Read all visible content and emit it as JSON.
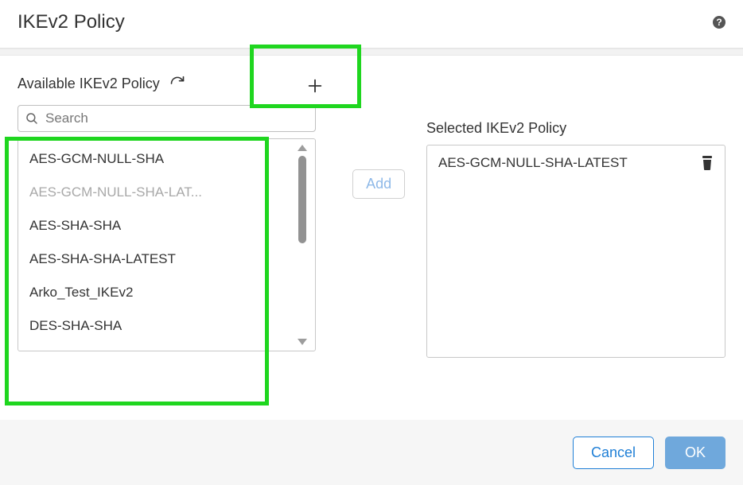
{
  "header": {
    "title": "IKEv2 Policy",
    "help_icon_label": "?"
  },
  "available": {
    "title": "Available IKEv2 Policy",
    "search_placeholder": "Search",
    "items": [
      {
        "label": "AES-GCM-NULL-SHA",
        "disabled": false
      },
      {
        "label": "AES-GCM-NULL-SHA-LAT...",
        "disabled": true
      },
      {
        "label": "AES-SHA-SHA",
        "disabled": false
      },
      {
        "label": "AES-SHA-SHA-LATEST",
        "disabled": false
      },
      {
        "label": "Arko_Test_IKEv2",
        "disabled": false
      },
      {
        "label": "DES-SHA-SHA",
        "disabled": false
      }
    ]
  },
  "actions": {
    "add_label": "Add"
  },
  "selected": {
    "title": "Selected IKEv2 Policy",
    "items": [
      {
        "label": "AES-GCM-NULL-SHA-LATEST"
      }
    ]
  },
  "footer": {
    "cancel": "Cancel",
    "ok": "OK"
  }
}
